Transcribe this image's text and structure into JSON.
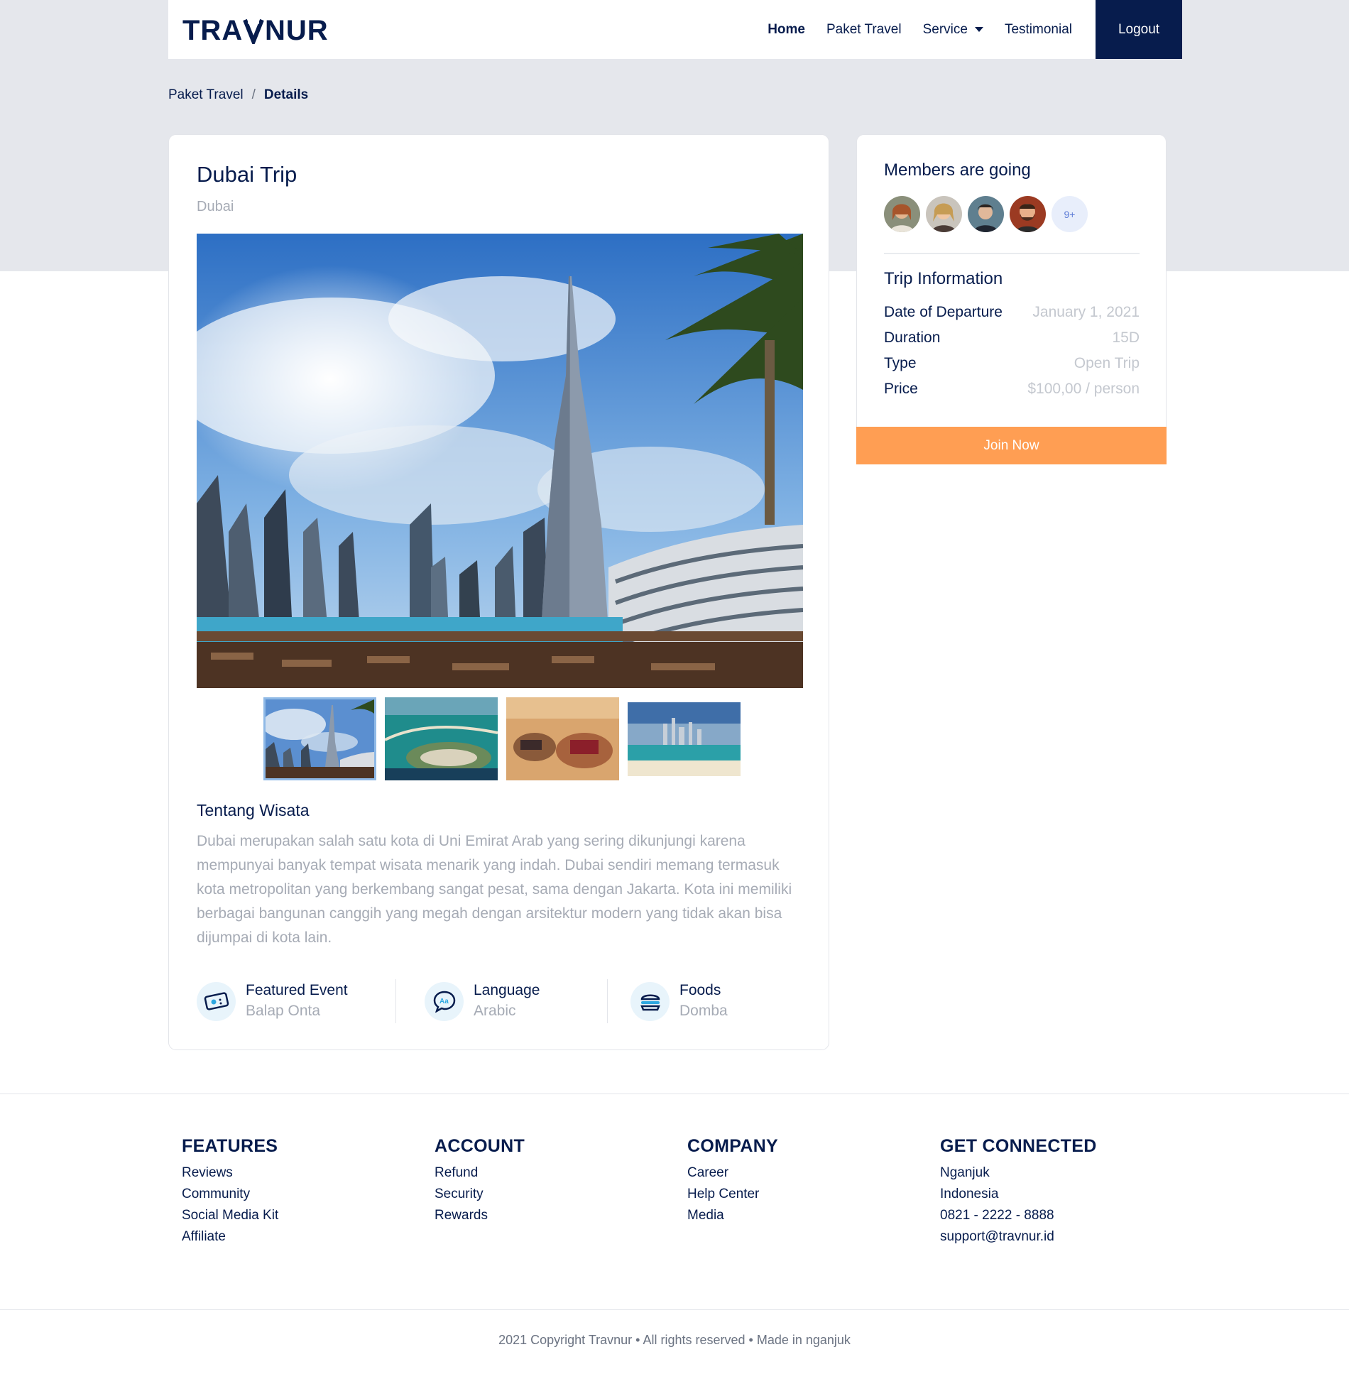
{
  "brand": {
    "name": "TRAVNUR"
  },
  "nav": {
    "items": [
      {
        "label": "Home",
        "active": true
      },
      {
        "label": "Paket Travel",
        "active": false
      },
      {
        "label": "Service",
        "active": false,
        "dropdown": true
      },
      {
        "label": "Testimonial",
        "active": false
      }
    ],
    "logout_label": "Logout"
  },
  "breadcrumb": {
    "parent": "Paket Travel",
    "separator": "/",
    "current": "Details"
  },
  "trip": {
    "title": "Dubai Trip",
    "location": "Dubai",
    "about_title": "Tentang Wisata",
    "about_text": "Dubai merupakan salah satu kota di Uni Emirat Arab yang sering dikunjungi karena mempunyai banyak tempat wisata menarik yang indah. Dubai sendiri memang termasuk kota metropolitan yang berkembang sangat pesat, sama dengan Jakarta. Kota ini memiliki berbagai bangunan canggih yang megah dengan arsitektur modern yang tidak akan bisa dijumpai di kota lain.",
    "features": [
      {
        "label": "Featured Event",
        "value": "Balap Onta",
        "icon": "ticket-icon"
      },
      {
        "label": "Language",
        "value": "Arabic",
        "icon": "chat-language-icon"
      },
      {
        "label": "Foods",
        "value": "Domba",
        "icon": "burger-icon"
      }
    ]
  },
  "members": {
    "title": "Members are going",
    "more_label": "9+"
  },
  "trip_info": {
    "title": "Trip Information",
    "rows": [
      {
        "key": "Date of Departure",
        "value": "January 1, 2021"
      },
      {
        "key": "Duration",
        "value": "15D"
      },
      {
        "key": "Type",
        "value": "Open Trip"
      },
      {
        "key": "Price",
        "value": "$100,00 / person"
      }
    ],
    "join_label": "Join Now"
  },
  "footer": {
    "columns": [
      {
        "title": "FEATURES",
        "items": [
          "Reviews",
          "Community",
          "Social Media Kit",
          "Affiliate"
        ]
      },
      {
        "title": "ACCOUNT",
        "items": [
          "Refund",
          "Security",
          "Rewards"
        ]
      },
      {
        "title": "COMPANY",
        "items": [
          "Career",
          "Help Center",
          "Media"
        ]
      },
      {
        "title": "GET CONNECTED",
        "items": [
          "Nganjuk",
          "Indonesia",
          "0821 - 2222 - 8888",
          "support@travnur.id"
        ]
      }
    ],
    "copyright": "2021 Copyright Travnur • All rights reserved • Made in nganjuk"
  },
  "colors": {
    "navy": "#071c4d",
    "accent_orange": "#ff9e53",
    "muted": "#a6abb5",
    "hero_bg": "#e5e7ec"
  }
}
